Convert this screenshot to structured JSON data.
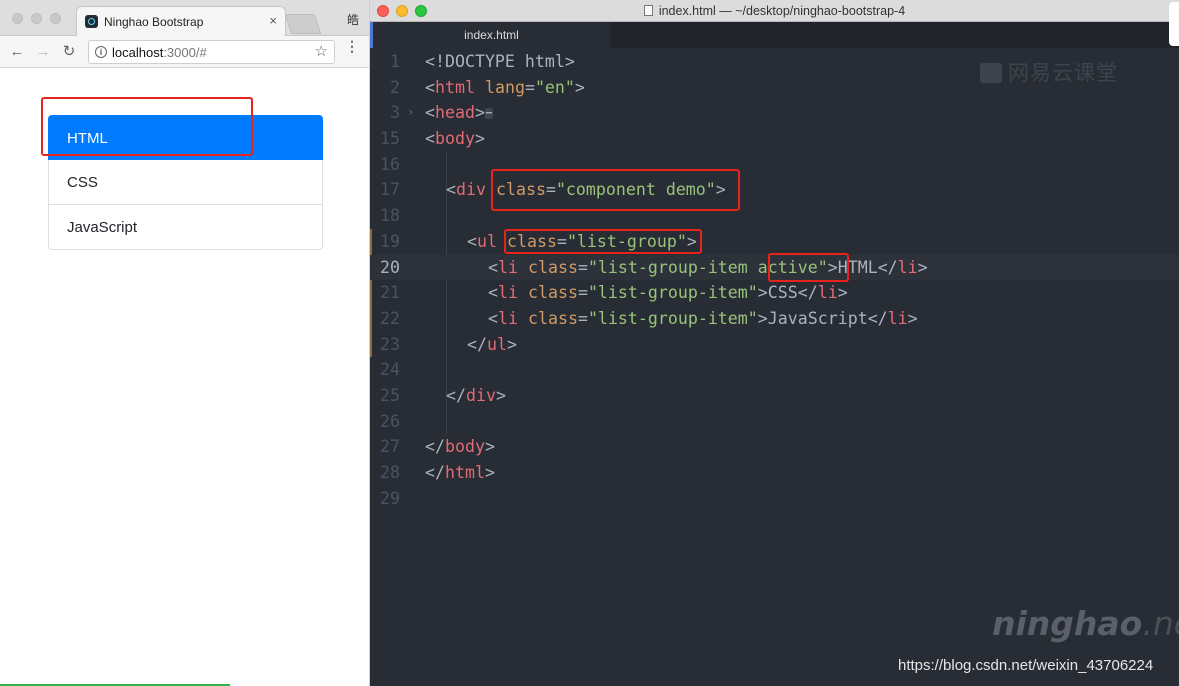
{
  "browser": {
    "tab_title": "Ninghao Bootstrap",
    "tab_close": "×",
    "profile_char": "皓",
    "url_host": "localhost",
    "url_rest": ":3000/#",
    "nav": {
      "back": "←",
      "forward": "→",
      "reload": "↻",
      "info": "i",
      "star": "☆",
      "menu": "⋮"
    },
    "list_items": [
      {
        "label": "HTML",
        "active": true
      },
      {
        "label": "CSS",
        "active": false
      },
      {
        "label": "JavaScript",
        "active": false
      }
    ],
    "active_color": "#007bff"
  },
  "editor": {
    "window_title": "index.html — ~/desktop/ninghao-bootstrap-4",
    "tab_label": "index.html",
    "current_line": "20",
    "lines": [
      {
        "n": "1"
      },
      {
        "n": "2"
      },
      {
        "n": "3"
      },
      {
        "n": "15"
      },
      {
        "n": "16"
      },
      {
        "n": "17"
      },
      {
        "n": "18"
      },
      {
        "n": "19"
      },
      {
        "n": "20"
      },
      {
        "n": "21"
      },
      {
        "n": "22"
      },
      {
        "n": "23"
      },
      {
        "n": "24"
      },
      {
        "n": "25"
      },
      {
        "n": "26"
      },
      {
        "n": "27"
      },
      {
        "n": "28"
      },
      {
        "n": "29"
      }
    ],
    "code": {
      "doctype": "<!DOCTYPE html>",
      "html_open_tag": "html",
      "lang_attr": "lang",
      "lang_val": "\"en\"",
      "head_tag": "head",
      "body_tag": "body",
      "div_tag": "div",
      "class_attr": "class",
      "div_class_val": "\"component demo\"",
      "ul_tag": "ul",
      "ul_class_val": "\"list-group\"",
      "li_tag": "li",
      "li_class_active": "\"list-group-item ",
      "active_word": "active\"",
      "li_class": "\"list-group-item\"",
      "text_html": "HTML",
      "text_css": "CSS",
      "text_js": "JavaScript",
      "ellipsis": "⋯"
    }
  },
  "watermarks": {
    "brand_cn": "网易云课堂",
    "brand_ninghao": "ninghao",
    "brand_net": ".net",
    "csdn_url": "https://blog.csdn.net/weixin_43706224"
  },
  "colors": {
    "editor_bg": "#282c34",
    "tag": "#e06c75",
    "attr": "#d19a66",
    "string": "#98c379",
    "highlight_box": "#e8231b"
  }
}
